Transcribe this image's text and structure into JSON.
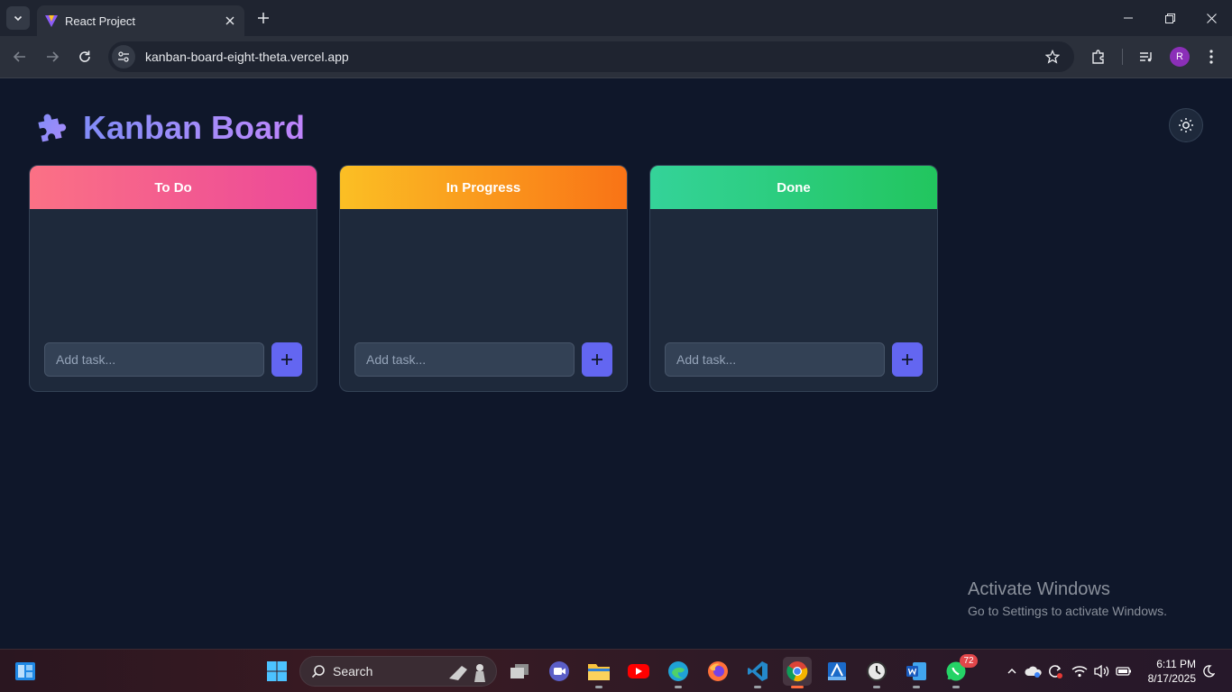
{
  "browser": {
    "tab_title": "React Project",
    "url": "kanban-board-eight-theta.vercel.app",
    "profile_initial": "R"
  },
  "app": {
    "title": "Kanban Board",
    "logo_icon": "puzzle-piece-icon",
    "theme_toggle_icon": "sun-icon"
  },
  "columns": [
    {
      "title": "To Do",
      "placeholder": "Add task...",
      "colors": [
        "#fb7185",
        "#ec4899"
      ]
    },
    {
      "title": "In Progress",
      "placeholder": "Add task...",
      "colors": [
        "#fbbf24",
        "#f97316"
      ]
    },
    {
      "title": "Done",
      "placeholder": "Add task...",
      "colors": [
        "#34d399",
        "#22c55e"
      ]
    }
  ],
  "watermark": {
    "title": "Activate Windows",
    "subtitle": "Go to Settings to activate Windows."
  },
  "taskbar": {
    "search_label": "Search",
    "whatsapp_badge": "72",
    "time": "6:11 PM",
    "date": "8/17/2025"
  },
  "colors": {
    "page_bg": "#0f172a",
    "card_bg": "#1e293b",
    "accent": "#6366f1"
  }
}
